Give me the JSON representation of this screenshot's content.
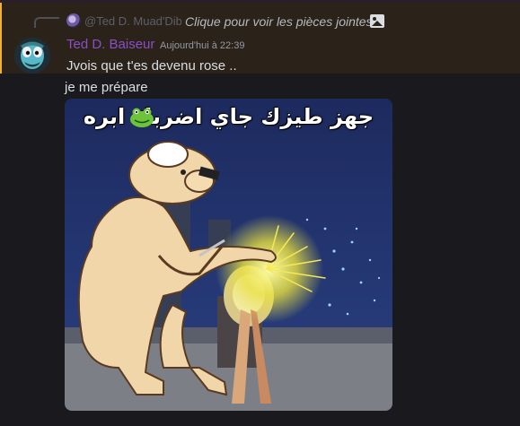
{
  "reply": {
    "author": "@Ted D. Muad'Dib",
    "content": "Clique pour voir les pièces jointes",
    "icon": "image-icon"
  },
  "message": {
    "author": "Ted D. Baiseur",
    "author_color": "#8a4fc7",
    "timestamp": "Aujourd'hui à 22:39",
    "lines": [
      "Jvois que t'es devenu rose ..",
      "je me prépare"
    ]
  },
  "attachment": {
    "caption": "جهز طيزك جاي اضربك ابره",
    "emoji": "frog-emoji"
  },
  "colors": {
    "background": "#1a1a1e",
    "highlight": "#2b2219",
    "mention_bar": "#f0b232"
  }
}
